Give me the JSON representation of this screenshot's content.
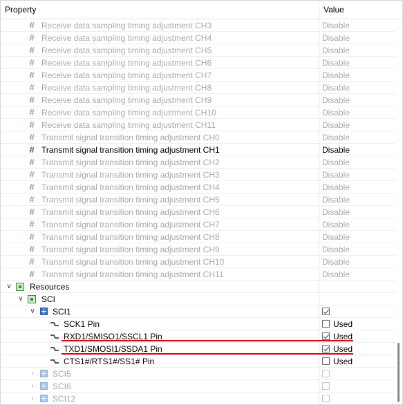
{
  "header": {
    "property": "Property",
    "value": "Value"
  },
  "params": [
    {
      "label": "Receive data sampling timing adjustment CH3",
      "value": "Disable",
      "dim": true
    },
    {
      "label": "Receive data sampling timing adjustment CH4",
      "value": "Disable",
      "dim": true
    },
    {
      "label": "Receive data sampling timing adjustment CH5",
      "value": "Disable",
      "dim": true
    },
    {
      "label": "Receive data sampling timing adjustment CH6",
      "value": "Disable",
      "dim": true
    },
    {
      "label": "Receive data sampling timing adjustment CH7",
      "value": "Disable",
      "dim": true
    },
    {
      "label": "Receive data sampling timing adjustment CH8",
      "value": "Disable",
      "dim": true
    },
    {
      "label": "Receive data sampling timing adjustment CH9",
      "value": "Disable",
      "dim": true
    },
    {
      "label": "Receive data sampling timing adjustment CH10",
      "value": "Disable",
      "dim": true
    },
    {
      "label": "Receive data sampling timing adjustment CH11",
      "value": "Disable",
      "dim": true
    },
    {
      "label": "Transmit signal transition timing adjustment CH0",
      "value": "Disable",
      "dim": true
    },
    {
      "label": "Transmit signal transition timing adjustment CH1",
      "value": "Disable",
      "dim": false
    },
    {
      "label": "Transmit signal transition timing adjustment CH2",
      "value": "Disable",
      "dim": true
    },
    {
      "label": "Transmit signal transition timing adjustment CH3",
      "value": "Disable",
      "dim": true
    },
    {
      "label": "Transmit signal transition timing adjustment CH4",
      "value": "Disable",
      "dim": true
    },
    {
      "label": "Transmit signal transition timing adjustment CH5",
      "value": "Disable",
      "dim": true
    },
    {
      "label": "Transmit signal transition timing adjustment CH6",
      "value": "Disable",
      "dim": true
    },
    {
      "label": "Transmit signal transition timing adjustment CH7",
      "value": "Disable",
      "dim": true
    },
    {
      "label": "Transmit signal transition timing adjustment CH8",
      "value": "Disable",
      "dim": true
    },
    {
      "label": "Transmit signal transition timing adjustment CH9",
      "value": "Disable",
      "dim": true
    },
    {
      "label": "Transmit signal transition timing adjustment CH10",
      "value": "Disable",
      "dim": true
    },
    {
      "label": "Transmit signal transition timing adjustment CH11",
      "value": "Disable",
      "dim": true
    }
  ],
  "tree": {
    "resources": "Resources",
    "sci": "SCI",
    "sci1": {
      "label": "SCI1",
      "checked": true
    },
    "pins": [
      {
        "label": "SCK1 Pin",
        "value": "Used",
        "checked": false
      },
      {
        "label": "RXD1/SMISO1/SSCL1 Pin",
        "value": "Used",
        "checked": true
      },
      {
        "label": "TXD1/SMOSI1/SSDA1 Pin",
        "value": "Used",
        "checked": true
      },
      {
        "label": "CTS1#/RTS1#/SS1# Pin",
        "value": "Used",
        "checked": false
      }
    ],
    "others": [
      "SCI5",
      "SCI6",
      "SCI12"
    ]
  },
  "colors": {
    "highlight_underline": "#e0001b",
    "hash_icon": "#2b5d8a",
    "disabled_text": "#a8a8a8"
  }
}
